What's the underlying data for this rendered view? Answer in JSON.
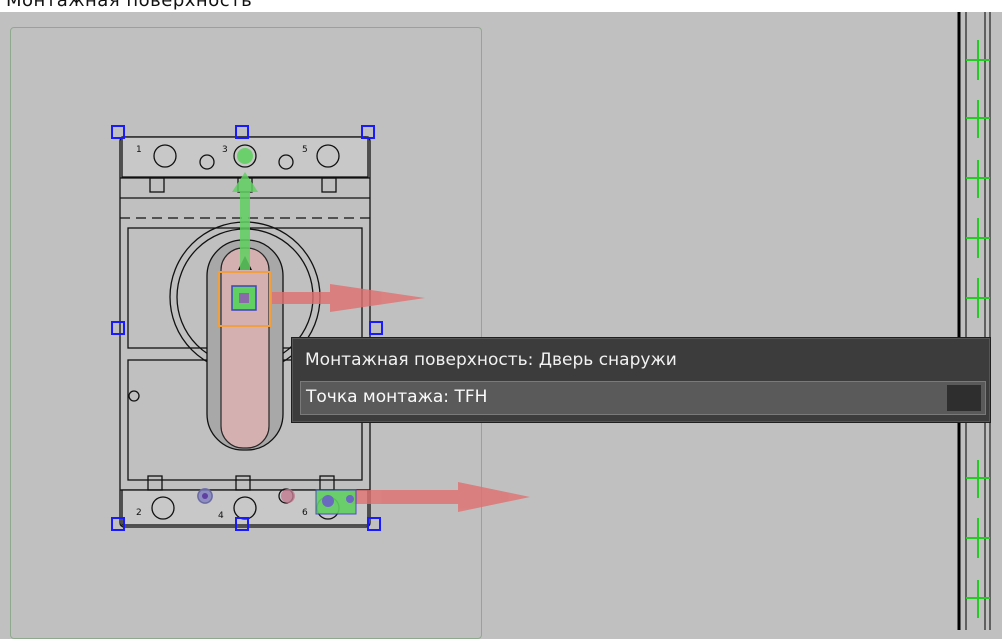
{
  "header": {
    "partial_text": "Монтажная поверхность"
  },
  "tooltip": {
    "mounting_surface": "Монтажная поверхность: Дверь снаружи",
    "mounting_point": "Точка монтажа: TFH"
  },
  "device": {
    "terminal_numbers_top": [
      "1",
      "3",
      "5"
    ],
    "terminal_numbers_bottom": [
      "2",
      "4",
      "6"
    ]
  },
  "colors": {
    "canvas": "#c0c0c0",
    "selection_handle": "#1a1aff",
    "axis_x": "#e07070",
    "axis_y": "#60d060",
    "mounting_point_marker": "#f0a040",
    "rail_tick": "#22cc22"
  }
}
